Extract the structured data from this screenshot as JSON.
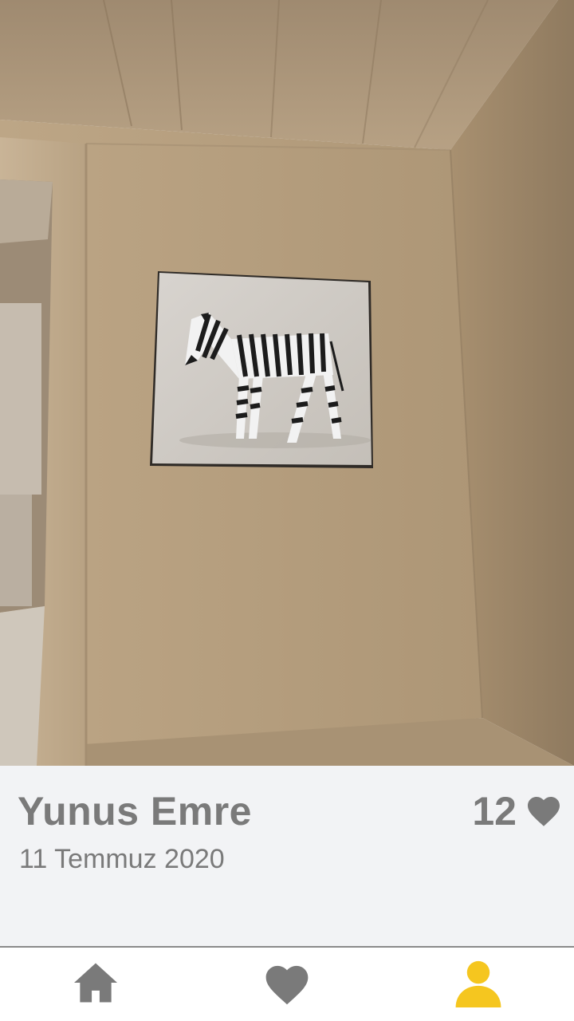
{
  "post": {
    "author": "Yunus Emre",
    "date": "11 Temmuz 2020",
    "likes": "12"
  },
  "icons": {
    "like": "heart-icon",
    "nav_home": "home-icon",
    "nav_favorites": "heart-icon",
    "nav_profile": "user-icon"
  },
  "colors": {
    "text": "#7a7a7a",
    "active": "#f5c61f",
    "inactive": "#7a7a7a"
  },
  "nav": {
    "active_item": "profile"
  }
}
